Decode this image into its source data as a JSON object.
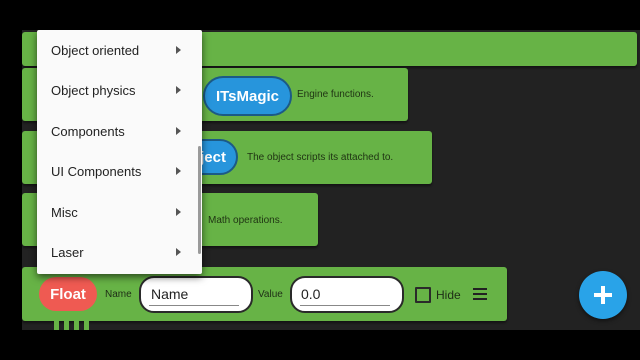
{
  "blocks": [
    {
      "pill": "ITsMagic",
      "description": "Engine functions."
    },
    {
      "pill": "ject",
      "description": "The object scripts its attached to."
    },
    {
      "pill": "",
      "description": "Math operations."
    }
  ],
  "dropdown_menu": {
    "items": [
      {
        "label": "Object oriented"
      },
      {
        "label": "Object physics"
      },
      {
        "label": "Components"
      },
      {
        "label": "UI Components"
      },
      {
        "label": "Misc"
      },
      {
        "label": "Laser"
      }
    ]
  },
  "variable_row": {
    "type_label": "Float",
    "name_label": "Name",
    "name_value": "Name",
    "value_label": "Value",
    "value_value": "0.0",
    "hide_label": "Hide",
    "hide_checked": false
  },
  "fab": {
    "icon": "plus-icon"
  },
  "colors": {
    "block_green": "#67b346",
    "pill_blue": "#2795dc",
    "float_red": "#ef5a52",
    "fab_blue": "#29a3e8"
  }
}
